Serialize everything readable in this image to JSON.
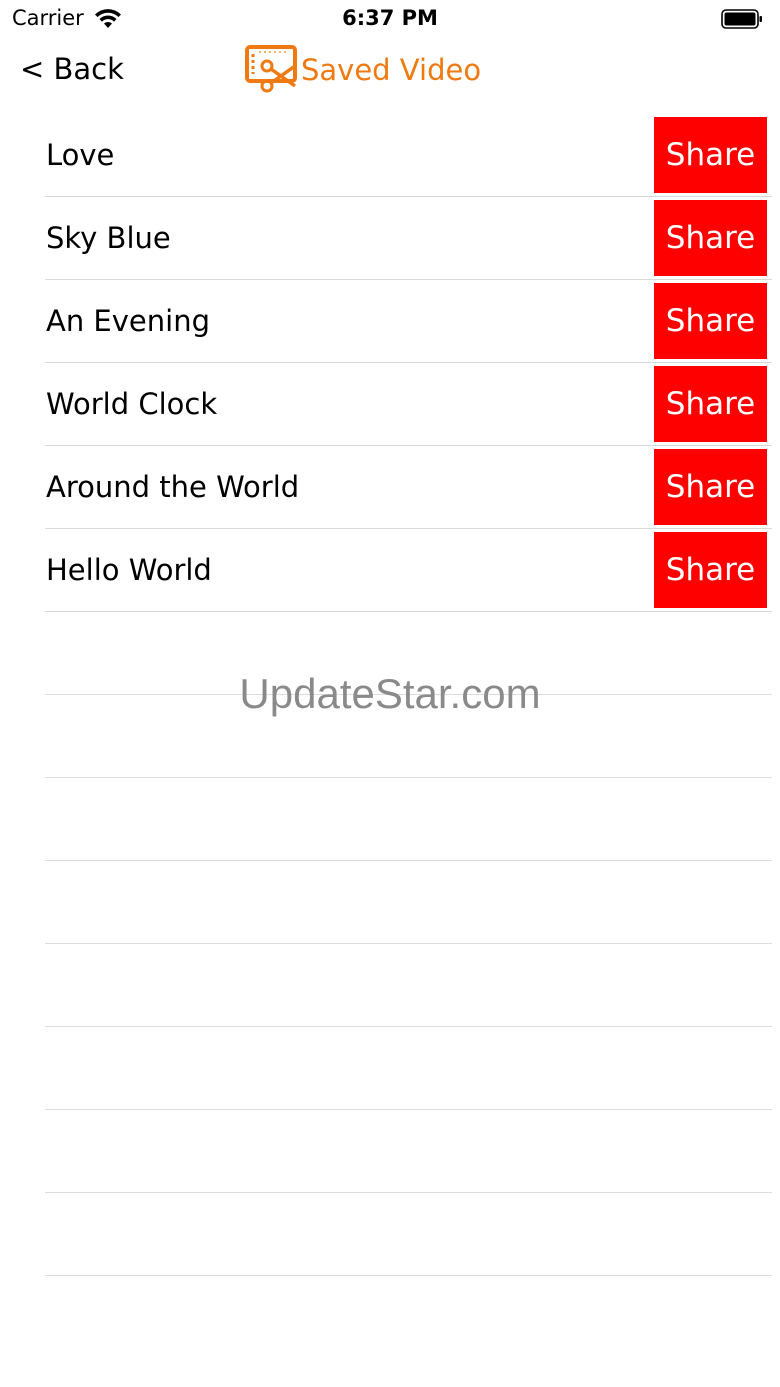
{
  "status_bar": {
    "carrier": "Carrier",
    "time": "6:37 PM",
    "wifi_icon": "wifi-icon",
    "battery_icon": "battery-icon"
  },
  "nav": {
    "back_label": "< Back",
    "title": "Saved Video",
    "logo_icon": "video-edit-logo-icon",
    "title_color": "#f07a12"
  },
  "videos": [
    {
      "title": "Love",
      "action": "Share"
    },
    {
      "title": "Sky Blue",
      "action": "Share"
    },
    {
      "title": "An Evening",
      "action": "Share"
    },
    {
      "title": "World Clock",
      "action": "Share"
    },
    {
      "title": "Around the World",
      "action": "Share"
    },
    {
      "title": "Hello World",
      "action": "Share"
    }
  ],
  "share_button_color": "#ff0000",
  "watermark": "UpdateStar.com"
}
